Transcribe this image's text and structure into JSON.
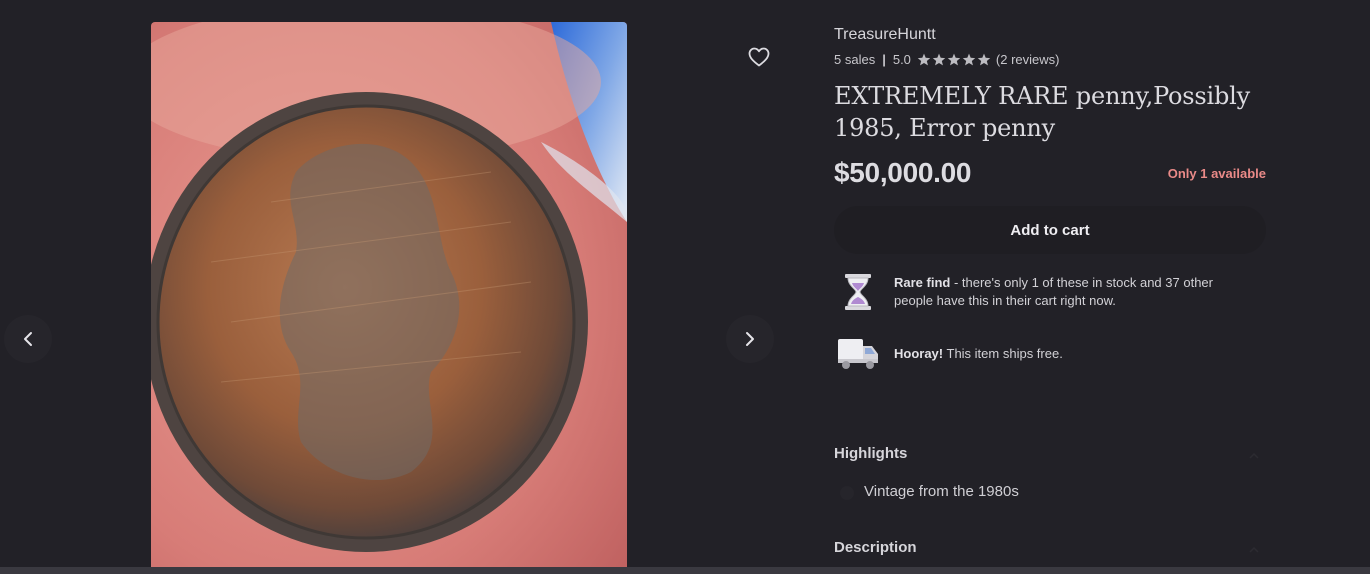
{
  "shop": {
    "name": "TreasureHuntt",
    "sales": "5 sales",
    "rating": "5.0",
    "stars": 5,
    "reviews": "(2 reviews)"
  },
  "listing": {
    "title": "EXTREMELY RARE penny,Possibly 1985, Error penny",
    "price": "$50,000.00",
    "stock_note": "Only 1 available",
    "add_to_cart": "Add to cart"
  },
  "notices": {
    "rare_bold": "Rare find",
    "rare_text": " - there's only 1 of these in stock and 37 other people have this in their cart right now.",
    "ship_bold": "Hooray!",
    "ship_text": " This item ships free."
  },
  "highlights": {
    "heading": "Highlights",
    "item": "Vintage from the 1980s"
  },
  "description": {
    "heading": "Description"
  },
  "icons": {
    "favorite": "heart-icon",
    "prev": "chevron-left-icon",
    "next": "chevron-right-icon",
    "rare": "hourglass-icon",
    "shipping": "truck-icon",
    "star": "star-icon"
  },
  "colors": {
    "background": "#222127",
    "stock_note": "#ea8a88",
    "button": "#1f1e23"
  }
}
